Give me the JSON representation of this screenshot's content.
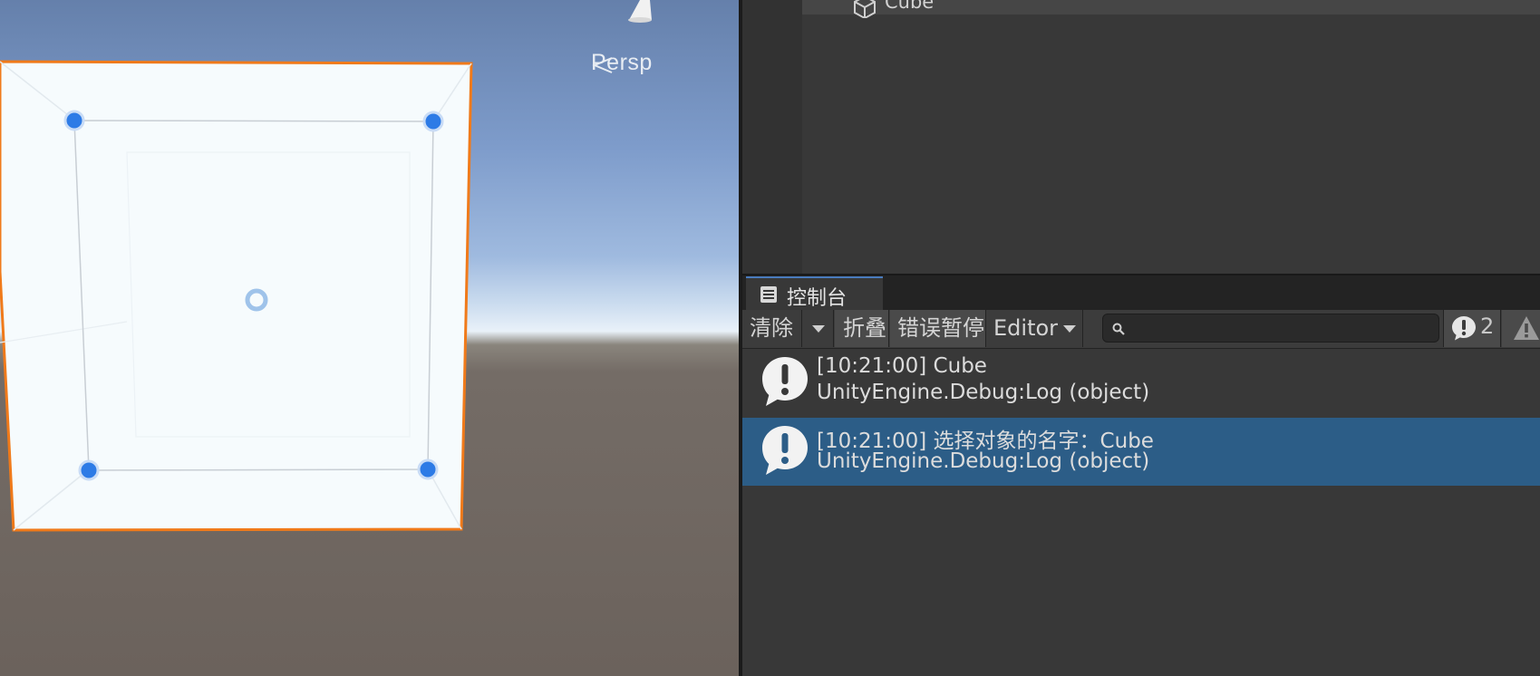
{
  "scene": {
    "projection_label": "Persp",
    "icons": [
      "scene-gizmo-cone-icon",
      "persp-arrow-icon",
      "rect-handle-icon",
      "pivot-icon"
    ]
  },
  "hierarchy": {
    "items": [
      {
        "label": "Cube",
        "icon": "cube-icon"
      }
    ]
  },
  "console": {
    "tab_label": "控制台",
    "tab_icon": "console-icon",
    "toolbar": {
      "clear_label": "清除",
      "collapse_label": "折叠",
      "error_pause_label": "错误暂停",
      "editor_label": "Editor",
      "search_value": "",
      "error_count": "2"
    },
    "entries": [
      {
        "line1": "[10:21:00] Cube",
        "line2": "UnityEngine.Debug:Log (object)",
        "selected": false
      },
      {
        "line1": "[10:21:00] 选择对象的名字：Cube",
        "line2": "UnityEngine.Debug:Log (object)",
        "selected": true
      }
    ]
  },
  "colors": {
    "selection_outline": "#f07a1a",
    "selected_row": "#2c5d87",
    "handle_blue": "#2d7be6"
  }
}
